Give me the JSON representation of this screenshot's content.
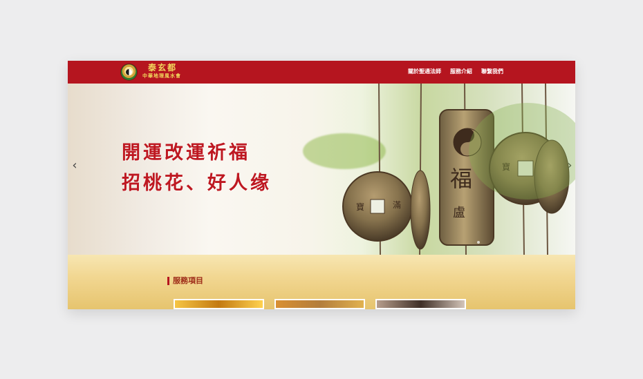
{
  "site": {
    "logo_title": "泰玄都",
    "logo_subtitle": "中華地理風水會"
  },
  "nav": {
    "items": [
      {
        "label": "關於聖通法師"
      },
      {
        "label": "服務介紹"
      },
      {
        "label": "聯繫我們"
      }
    ]
  },
  "hero": {
    "headline_line1": "開運改運祈福",
    "headline_line2": "招桃花、好人缘",
    "left_arrow": "‹",
    "right_arrow": "›"
  },
  "services": {
    "title": "服務項目"
  },
  "colors": {
    "brand_red": "#b5151f",
    "gold": "#f2d85d",
    "headline_red": "#be1821"
  }
}
